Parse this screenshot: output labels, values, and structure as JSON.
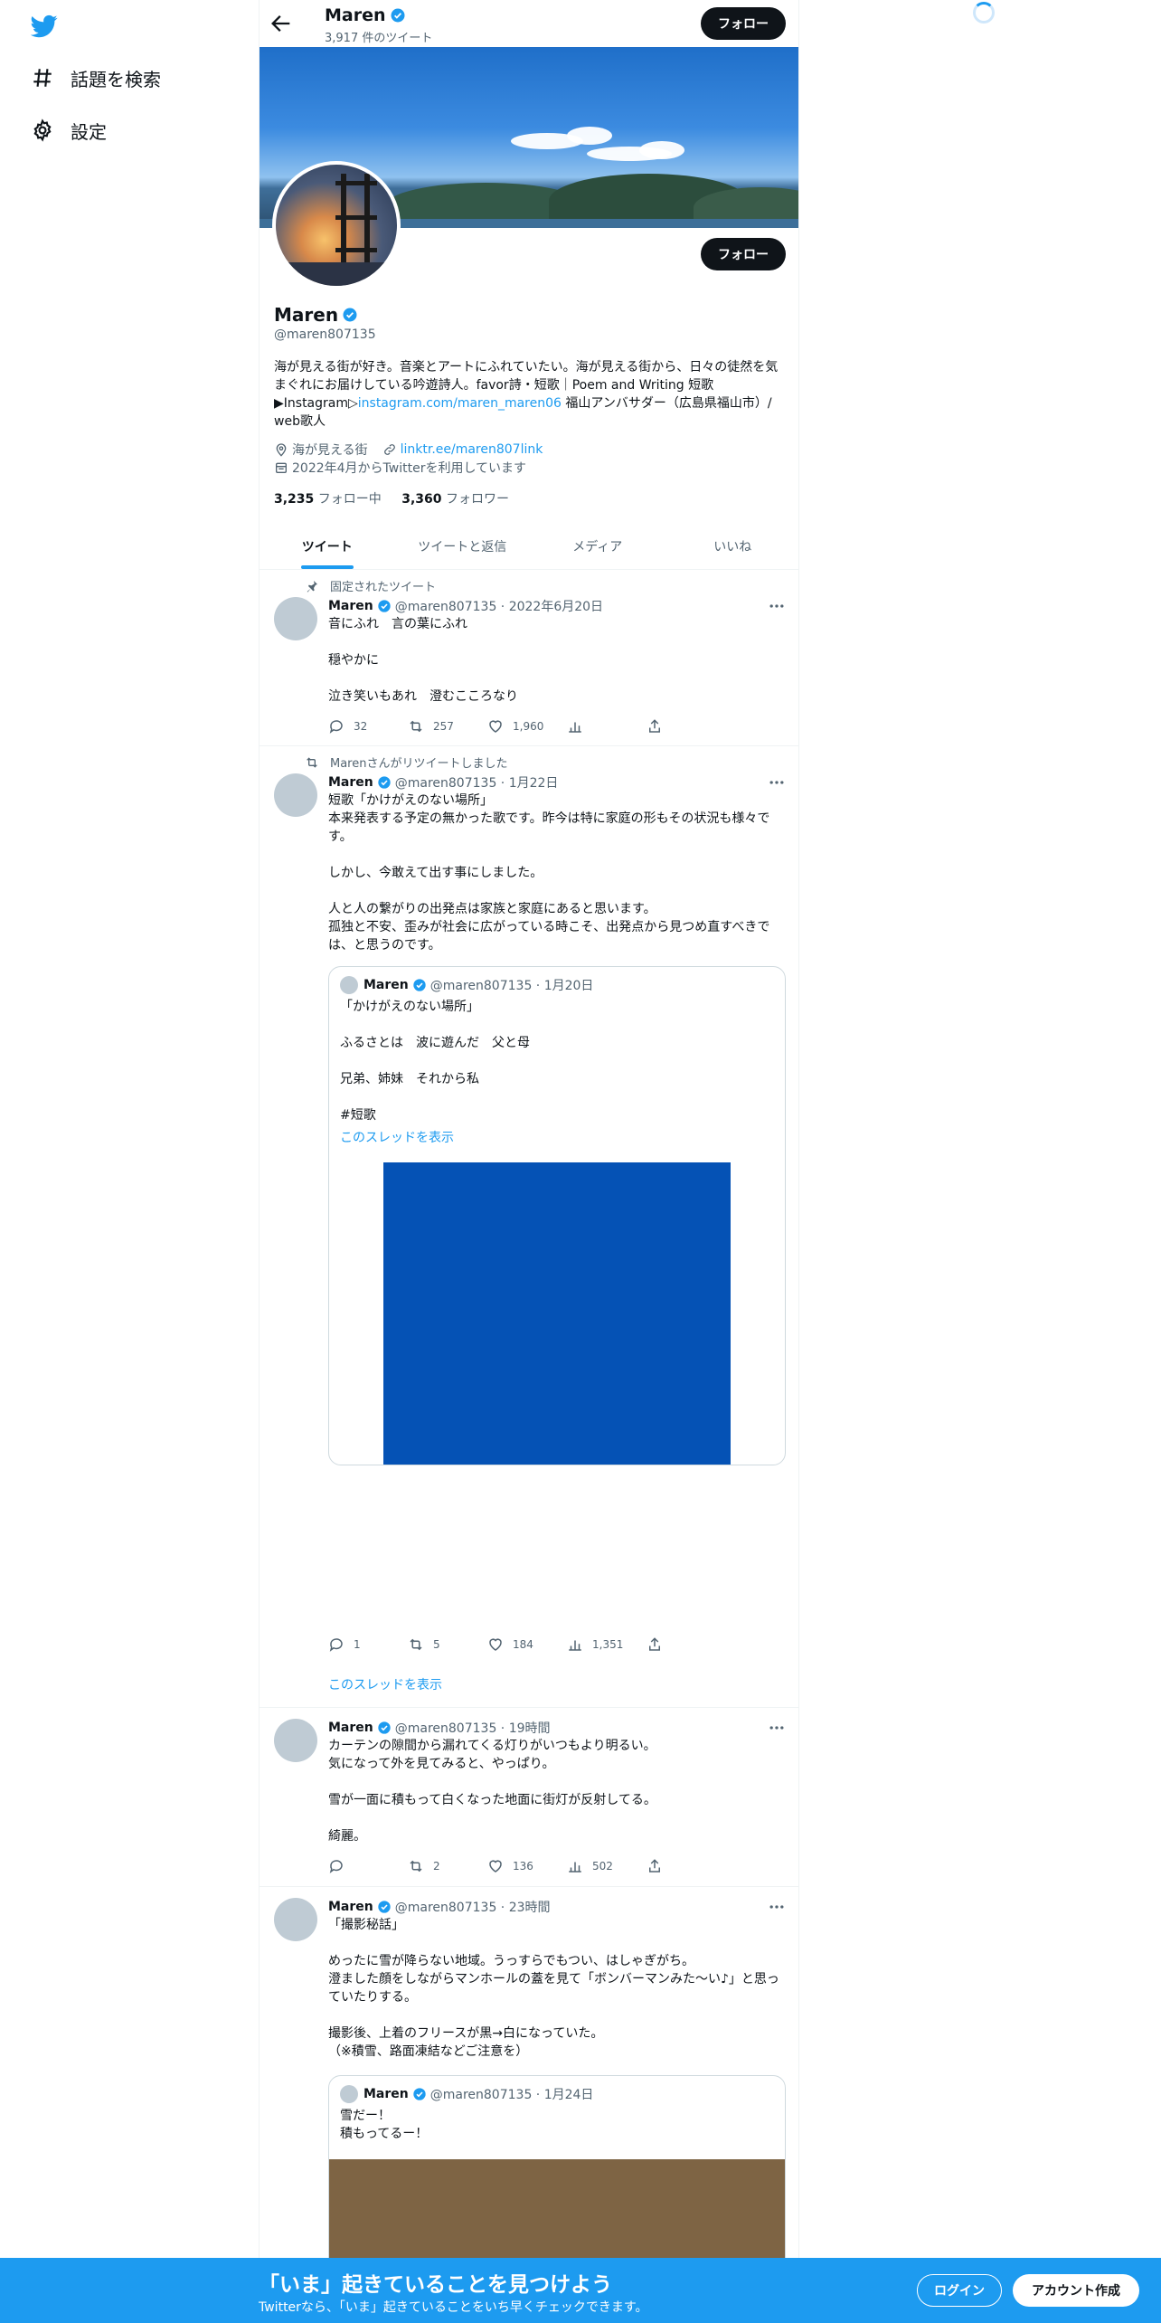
{
  "nav": {
    "items": [
      {
        "label": "話題を検索",
        "icon": "hashtag-icon"
      },
      {
        "label": "設定",
        "icon": "gear-icon"
      }
    ]
  },
  "header": {
    "name": "Maren",
    "tweet_count": "3,917 件のツイート",
    "follow_label": "フォロー"
  },
  "profile": {
    "name": "Maren",
    "handle": "@maren807135",
    "follow_label": "フォロー",
    "bio_part1": "海が見える街が好き。音楽とアートにふれていたい。海が見える街から、日々の徒然を気まぐれにお届けしている吟遊詩人。favor詩・短歌｜Poem and Writing 短歌▶Instagram▷",
    "bio_link": "instagram.com/maren_maren06",
    "bio_part2": " 福山アンバサダー（広島県福山市）/ web歌人",
    "location": "海が見える街",
    "website": "linktr.ee/maren807link",
    "joined": "2022年4月からTwitterを利用しています",
    "following_count": "3,235",
    "following_label": "フォロー中",
    "followers_count": "3,360",
    "followers_label": "フォロワー"
  },
  "tabs": [
    "ツイート",
    "ツイートと返信",
    "メディア",
    "いいね"
  ],
  "tweets": [
    {
      "context": "固定されたツイート",
      "name": "Maren",
      "meta": "@maren807135 · 2022年6月20日",
      "text": "音にふれ　言の葉にふれ\n\n穏やかに\n\n泣き笑いもあれ　澄むこころなり",
      "replies": "32",
      "retweets": "257",
      "likes": "1,960"
    },
    {
      "context": "Marenさんがリツイートしました",
      "name": "Maren",
      "meta": "@maren807135 · 1月22日",
      "text": "短歌「かけがえのない場所」\n本来発表する予定の無かった歌です。昨今は特に家庭の形もその状況も様々です。\n\nしかし、今敢えて出す事にしました。\n\n人と人の繋がりの出発点は家族と家庭にあると思います。\n孤独と不安、歪みが社会に広がっている時こそ、出発点から見つめ直すべきでは、と思うのです。",
      "quote": {
        "name": "Maren",
        "meta": "@maren807135 · 1月20日",
        "text": "「かけがえのない場所」\n\nふるさとは　波に遊んだ　父と母\n\n兄弟、姉妹　それから私\n\n#短歌",
        "show_thread": "このスレッドを表示"
      },
      "replies": "1",
      "retweets": "5",
      "likes": "184",
      "views": "1,351",
      "show_thread": "このスレッドを表示"
    },
    {
      "name": "Maren",
      "meta": "@maren807135 · 19時間",
      "text": "カーテンの隙間から漏れてくる灯りがいつもより明るい。\n気になって外を見てみると、やっぱり。\n\n雪が一面に積もって白くなった地面に街灯が反射してる。\n\n綺麗。",
      "retweets": "2",
      "likes": "136",
      "views": "502"
    },
    {
      "name": "Maren",
      "meta": "@maren807135 · 23時間",
      "text": "「撮影秘話」\n\nめったに雪が降らない地域。うっすらでもつい、はしゃぎがち。\n澄ました顔をしながらマンホールの蓋を見て「ボンバーマンみた〜い♪」と思っていたりする。\n\n撮影後、上着のフリースが黒→白になっていた。\n（※積雪、路面凍結などご注意を）",
      "quote": {
        "name": "Maren",
        "meta": "@maren807135 · 1月24日",
        "text": "雪だー！\n積もってるー！"
      }
    }
  ],
  "bottom_bar": {
    "title": "「いま」起きていることを見つけよう",
    "subtitle": "Twitterなら、「いま」起きていることをいち早くチェックできます。",
    "login": "ログイン",
    "signup": "アカウント作成"
  },
  "colors": {
    "accent": "#1d9bf0",
    "text": "#0f1419",
    "secondary": "#536471",
    "quote_image_1": "#0552b5",
    "quote_image_2": "#7e6444"
  }
}
